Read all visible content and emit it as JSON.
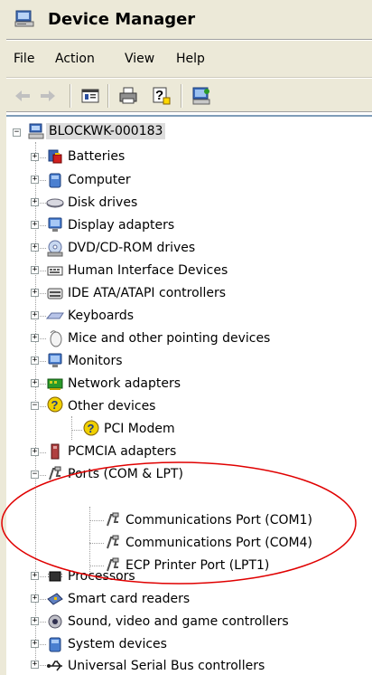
{
  "window": {
    "title": "Device Manager"
  },
  "menu": {
    "items": [
      "File",
      "Action",
      "View",
      "Help"
    ]
  },
  "toolbar": {
    "buttons": [
      "back-arrow",
      "forward-arrow",
      "properties",
      "print",
      "help",
      "scan-hardware"
    ]
  },
  "tree": {
    "root": "BLOCKWK-000183",
    "categories": [
      {
        "label": "Batteries",
        "icon": "battery-icon",
        "expanded": false
      },
      {
        "label": "Computer",
        "icon": "computer-icon",
        "expanded": false
      },
      {
        "label": "Disk drives",
        "icon": "disk-drive-icon",
        "expanded": false
      },
      {
        "label": "Display adapters",
        "icon": "monitor-icon",
        "expanded": false
      },
      {
        "label": "DVD/CD-ROM drives",
        "icon": "cd-drive-icon",
        "expanded": false
      },
      {
        "label": "Human Interface Devices",
        "icon": "hid-icon",
        "expanded": false
      },
      {
        "label": "IDE ATA/ATAPI controllers",
        "icon": "ide-controller-icon",
        "expanded": false
      },
      {
        "label": "Keyboards",
        "icon": "keyboard-icon",
        "expanded": false
      },
      {
        "label": "Mice and other pointing devices",
        "icon": "mouse-icon",
        "expanded": false
      },
      {
        "label": "Monitors",
        "icon": "monitor-icon",
        "expanded": false
      },
      {
        "label": "Network adapters",
        "icon": "network-adapter-icon",
        "expanded": false
      },
      {
        "label": "Other devices",
        "icon": "unknown-device-icon",
        "expanded": true,
        "children": [
          {
            "label": "PCI Modem",
            "icon": "unknown-device-icon"
          }
        ]
      },
      {
        "label": "PCMCIA adapters",
        "icon": "pcmcia-icon",
        "expanded": false
      },
      {
        "label": "Ports (COM & LPT)",
        "icon": "port-icon",
        "expanded": true,
        "children": [
          {
            "label": "Communications Port (COM1)",
            "icon": "port-icon"
          },
          {
            "label": "Communications Port (COM4)",
            "icon": "port-icon"
          },
          {
            "label": "ECP Printer Port (LPT1)",
            "icon": "port-icon"
          }
        ]
      },
      {
        "label": "Processors",
        "icon": "processor-icon",
        "expanded": false
      },
      {
        "label": "Smart card readers",
        "icon": "smart-card-icon",
        "expanded": false
      },
      {
        "label": "Sound, video and game controllers",
        "icon": "sound-icon",
        "expanded": false
      },
      {
        "label": "System devices",
        "icon": "system-devices-icon",
        "expanded": false
      },
      {
        "label": "Universal Serial Bus controllers",
        "icon": "usb-icon",
        "expanded": false
      }
    ]
  },
  "annotation": {
    "shape": "ellipse",
    "color": "#e00000",
    "highlights": "Ports (COM & LPT)"
  }
}
